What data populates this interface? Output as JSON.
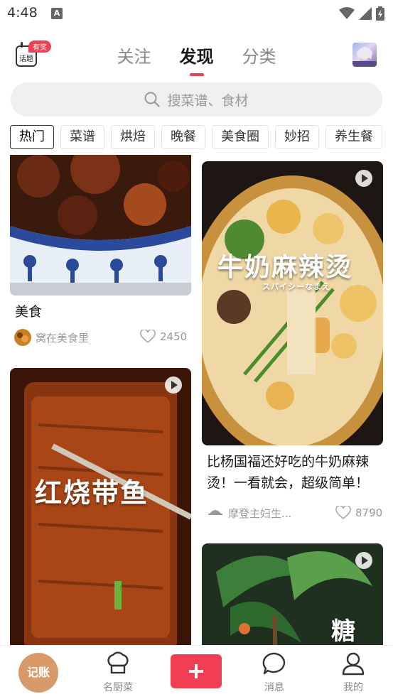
{
  "status_bar": {
    "time": "4:48",
    "notification_badge": "A"
  },
  "header": {
    "topic": {
      "label": "话题",
      "badge": "有奖"
    },
    "tabs": [
      {
        "label": "关注"
      },
      {
        "label": "发现"
      },
      {
        "label": "分类"
      }
    ],
    "active_tab": "发现"
  },
  "search": {
    "placeholder": "搜菜谱、食材"
  },
  "categories": [
    "热门",
    "菜谱",
    "烘焙",
    "晚餐",
    "美食圈",
    "妙招",
    "养生餐"
  ],
  "feed": {
    "left": [
      {
        "title": "美食",
        "author": "窝在美食里",
        "likes": "2450"
      },
      {
        "overlay_text": "红烧带鱼"
      }
    ],
    "right": [
      {
        "overlay_text": "牛奶麻辣烫",
        "overlay_subtext": "スパイシーなまえ",
        "title_line1": "比杨国福还好吃的牛奶麻辣",
        "title_line2": "烫！一看就会，超级简单！",
        "author": "摩登主妇生...",
        "likes": "8790"
      },
      {
        "overlay_text": "糖"
      }
    ]
  },
  "bottom_nav": {
    "jizhang": "记账",
    "chef": "名厨菜",
    "messages": "消息",
    "mine": "我的"
  },
  "colors": {
    "accent": "#f03e53",
    "jizhang": "#d99a6a"
  }
}
